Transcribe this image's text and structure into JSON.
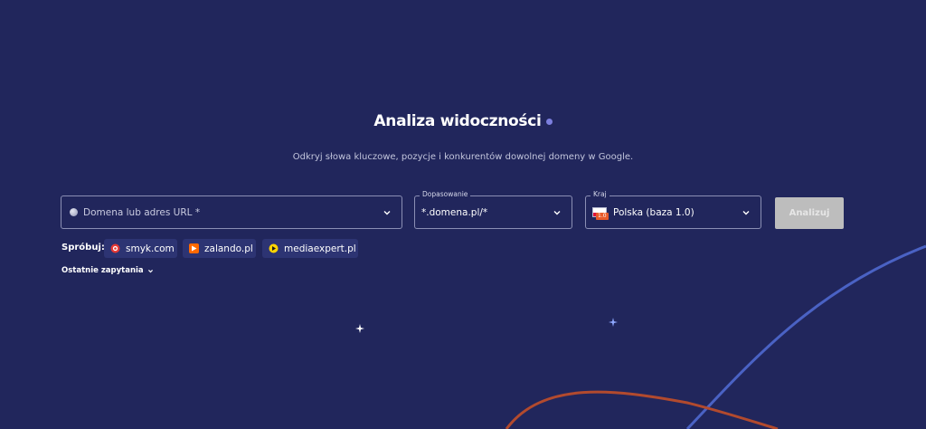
{
  "header": {
    "title": "Analiza widoczności",
    "subtitle": "Odkryj słowa kluczowe, pozycje i konkurentów dowolnej domeny w Google."
  },
  "form": {
    "domain": {
      "placeholder": "Domena lub adres URL *",
      "icon": "globe-icon"
    },
    "match": {
      "label": "Dopasowanie",
      "value": "*.domena.pl/*"
    },
    "country": {
      "label": "Kraj",
      "value": "Polska (baza 1.0)",
      "flag_badge": "1.0"
    },
    "submit_label": "Analizuj"
  },
  "suggestions": {
    "label": "Spróbuj:",
    "items": [
      {
        "label": "smyk.com",
        "icon": "smyk-logo-icon",
        "color": "#e53935"
      },
      {
        "label": "zalando.pl",
        "icon": "zalando-logo-icon",
        "color": "#ff6900"
      },
      {
        "label": "mediaexpert.pl",
        "icon": "mediaexpert-logo-icon",
        "color": "#ffd400"
      }
    ]
  },
  "recent": {
    "label": "Ostatnie zapytania"
  },
  "colors": {
    "background": "#21265c",
    "accent_dot": "#7c7fe0",
    "curve_blue": "#4a62c4",
    "curve_orange": "#b24a2e",
    "button_disabled": "#bdbdbd"
  }
}
